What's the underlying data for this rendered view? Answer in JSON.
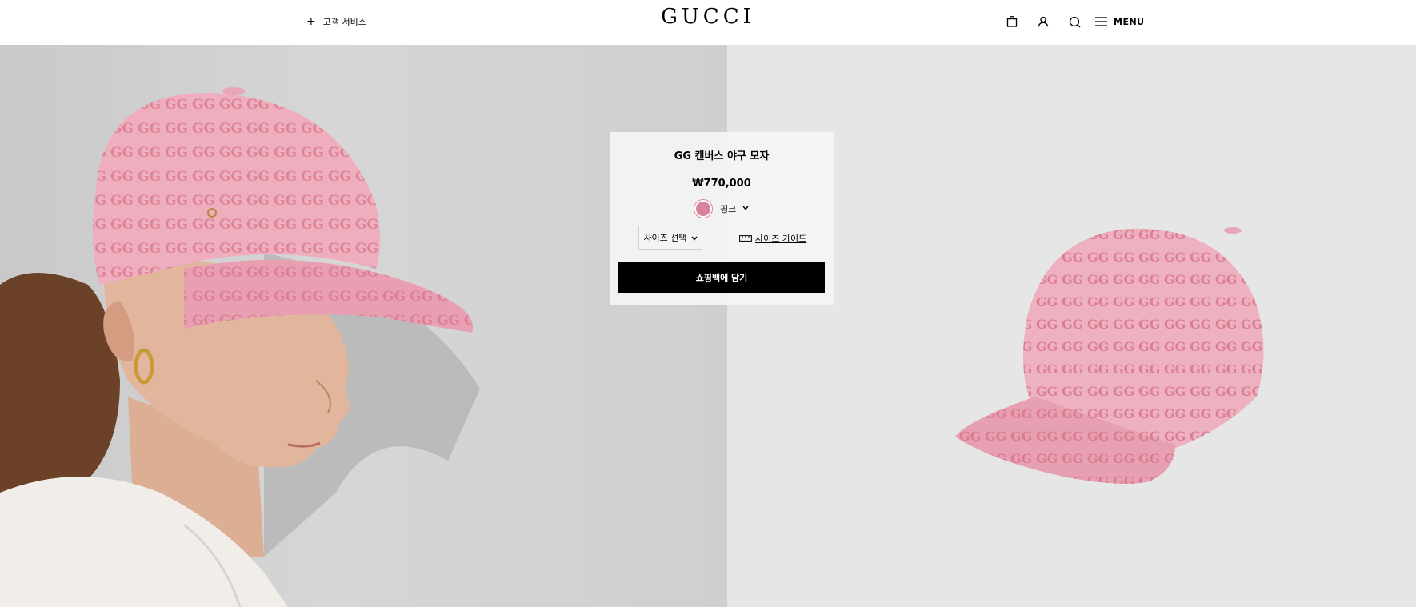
{
  "header": {
    "customer_service": "고객 서비스",
    "logo": "GUCCI",
    "menu_label": "MENU"
  },
  "product": {
    "title": "GG 캔버스 야구 모자",
    "price": "₩770,000",
    "color": {
      "name": "핑크",
      "swatch": "#d9839a"
    },
    "size_select_label": "사이즈 선택",
    "size_guide_label": "사이즈 가이드",
    "add_to_bag_label": "쇼핑백에 담기"
  },
  "colors": {
    "cap_pink": "#eeaebd",
    "gg_pattern": "#d9768e",
    "hoodie": "#f1eeea",
    "hair": "#6b4127",
    "skin": "#e2b69c"
  }
}
